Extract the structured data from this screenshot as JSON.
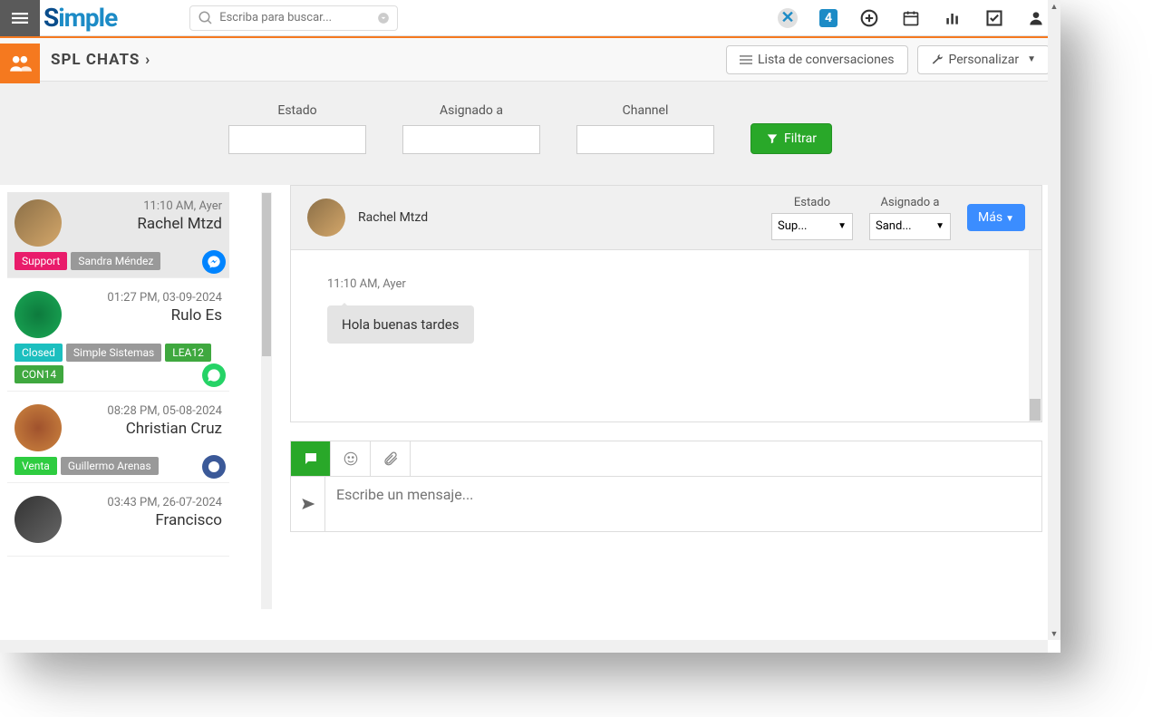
{
  "search": {
    "placeholder": "Escriba para buscar..."
  },
  "page": {
    "title": "SPL CHATS"
  },
  "header_buttons": {
    "list": "Lista de conversaciones",
    "customize": "Personalizar"
  },
  "filters": {
    "estado": "Estado",
    "asignado": "Asignado a",
    "channel": "Channel",
    "filtrar": "Filtrar"
  },
  "chats": [
    {
      "time": "11:10 AM, Ayer",
      "name": "Rachel Mtzd",
      "tags": [
        {
          "text": "Support",
          "cls": "pink"
        },
        {
          "text": "Sandra Méndez",
          "cls": "gray"
        }
      ],
      "channel": "messenger"
    },
    {
      "time": "01:27 PM, 03-09-2024",
      "name": "Rulo Es",
      "tags": [
        {
          "text": "Closed",
          "cls": "teal"
        },
        {
          "text": "Simple Sistemas",
          "cls": "gray"
        },
        {
          "text": "LEA12",
          "cls": "green"
        },
        {
          "text": "CON14",
          "cls": "green"
        }
      ],
      "channel": "whatsapp"
    },
    {
      "time": "08:28 PM, 05-08-2024",
      "name": "Christian Cruz",
      "tags": [
        {
          "text": "Venta",
          "cls": "lime"
        },
        {
          "text": "Guillermo Arenas",
          "cls": "gray"
        }
      ],
      "channel": "blue"
    },
    {
      "time": "03:43 PM, 26-07-2024",
      "name": "Francisco",
      "tags": []
    }
  ],
  "detail": {
    "name": "Rachel Mtzd",
    "estado_label": "Estado",
    "estado_value": "Sup...",
    "asignado_label": "Asignado a",
    "asignado_value": "Sand...",
    "mas": "Más",
    "msg_time": "11:10 AM, Ayer",
    "msg_text": "Hola buenas tardes",
    "compose_placeholder": "Escribe un mensaje..."
  },
  "icons": {
    "x_badge": "✕",
    "cal": "📅"
  }
}
